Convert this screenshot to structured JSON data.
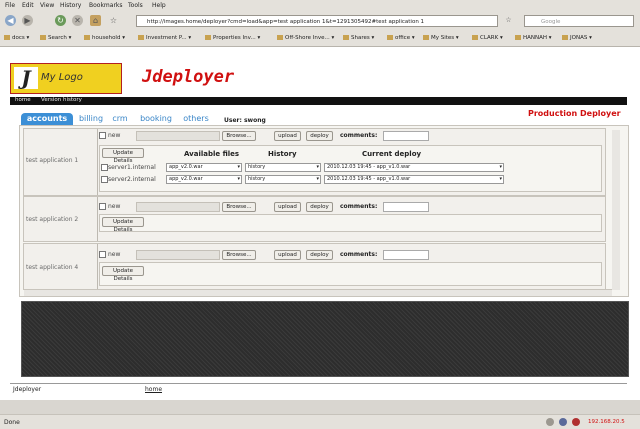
{
  "browser": {
    "menu": [
      "File",
      "Edit",
      "View",
      "History",
      "Bookmarks",
      "Tools",
      "Help"
    ],
    "url": "http://images.home/deployer?cmd=load&app=test application 1&t=1291305492#test application 1",
    "search_placeholder": "Google",
    "bookmarks": [
      "docs",
      "Search",
      "household",
      "Investment P...",
      "Properties Inv...",
      "Off-Shore Inve...",
      "Shares",
      "office",
      "My Sites",
      "CLARK",
      "HANNAH",
      "JONAS"
    ],
    "status": "Done",
    "status_ip": "192.168.20.5"
  },
  "app": {
    "logo_letter": "J",
    "logo_text": "My Logo",
    "title": "Jdeployer",
    "nav": [
      "home",
      "Version history"
    ],
    "env_label": "Production Deployer",
    "user_label": "User: swong",
    "tabs": [
      "accounts",
      "billing",
      "crm",
      "booking",
      "others"
    ],
    "active_tab": "accounts"
  },
  "controls": {
    "new_label": "new",
    "browse": "Browse...",
    "upload": "upload",
    "deploy": "deploy",
    "comments": "comments:",
    "update_details": "Update Details"
  },
  "details_headers": {
    "available": "Available files",
    "history": "History",
    "current": "Current deploy"
  },
  "applications": [
    {
      "name": "test application 1",
      "servers": [
        {
          "name": "server1.internal",
          "file": "app_v2.0.war",
          "history": "history",
          "current": "2010.12.03 19:45 - app_v1.0.war"
        },
        {
          "name": "server2.internal",
          "file": "app_v2.0.war",
          "history": "history",
          "current": "2010.12.03 19:45 - app_v1.0.war"
        }
      ]
    },
    {
      "name": "test application 2"
    },
    {
      "name": "test application 4"
    }
  ],
  "footer": {
    "name": "Jdeployer",
    "home": "home"
  }
}
